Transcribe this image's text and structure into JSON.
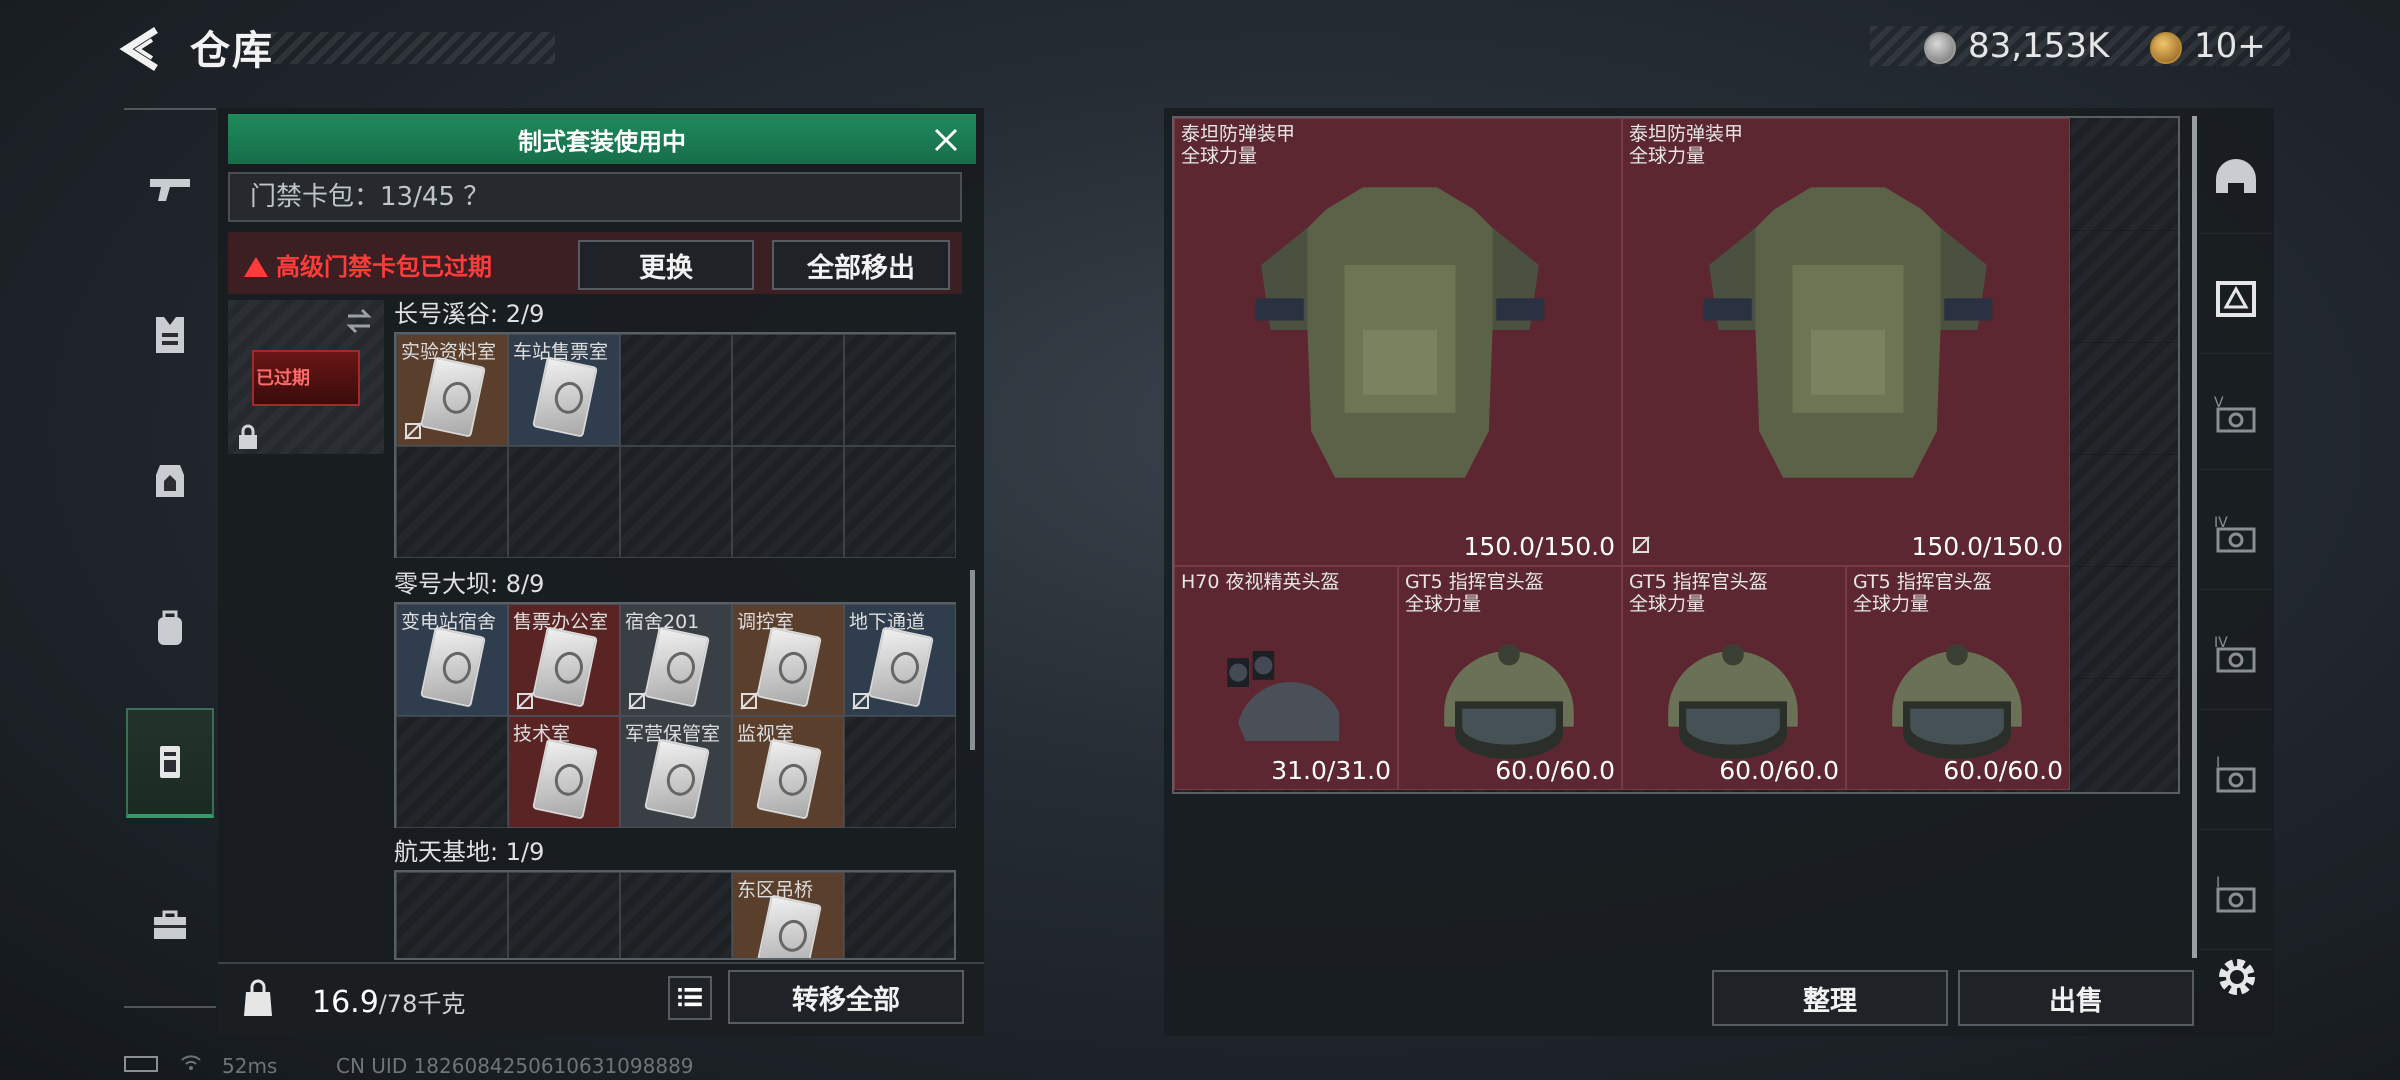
{
  "header": {
    "title": "仓库"
  },
  "currency": {
    "silver": "83,153K",
    "gold": "10+"
  },
  "left_panel": {
    "suit_banner": "制式套装使用中",
    "keycard_count": "门禁卡包：13/45 ？",
    "warning": "高级门禁卡包已过期",
    "replace_label": "更换",
    "remove_all_label": "全部移出",
    "card_slot_label": "已过期",
    "sections": [
      {
        "label": "长号溪谷: 2/9",
        "items": [
          {
            "name": "实验资料室",
            "color": "brown",
            "nobind": true
          },
          {
            "name": "车站售票室",
            "color": "blue",
            "nobind": false
          }
        ]
      },
      {
        "label": "零号大坝: 8/9",
        "items": [
          {
            "name": "变电站宿舍",
            "color": "blue",
            "nobind": false
          },
          {
            "name": "售票办公室",
            "color": "red",
            "nobind": true
          },
          {
            "name": "宿舍201",
            "color": "gray",
            "nobind": true
          },
          {
            "name": "调控室",
            "color": "brown",
            "nobind": true
          },
          {
            "name": "地下通道",
            "color": "blue",
            "nobind": true
          },
          {
            "name": "技术室",
            "color": "red",
            "nobind": false
          },
          {
            "name": "军营保管室",
            "color": "gray",
            "nobind": false
          },
          {
            "name": "监视室",
            "color": "brown",
            "nobind": false
          }
        ]
      },
      {
        "label": "航天基地: 1/9",
        "items": [
          {
            "name": "东区吊桥",
            "color": "brown",
            "nobind": false
          }
        ]
      }
    ],
    "weight_current": "16.9",
    "weight_max": "/78千克",
    "transfer_all_label": "转移全部"
  },
  "right_panel": {
    "items": [
      {
        "name": "泰坦防弹装甲\n全球力量",
        "durability": "150.0/150.0",
        "nobind": false
      },
      {
        "name": "泰坦防弹装甲\n全球力量",
        "durability": "150.0/150.0",
        "nobind": true
      },
      {
        "name": "H70 夜视精英头盔",
        "durability": "31.0/31.0",
        "nobind": false
      },
      {
        "name": "GT5 指挥官头盔\n全球力量",
        "durability": "60.0/60.0",
        "nobind": false
      },
      {
        "name": "GT5 指挥官头盔\n全球力量",
        "durability": "60.0/60.0",
        "nobind": false
      },
      {
        "name": "GT5 指挥官头盔\n全球力量",
        "durability": "60.0/60.0",
        "nobind": false
      }
    ],
    "sort_label": "整理",
    "sell_label": "出售",
    "side_filters": [
      "V",
      "IV",
      "IV",
      "I",
      "I"
    ]
  },
  "status_bar": {
    "ping": "52ms",
    "uid": "CN UID 1826084250610631098889"
  }
}
